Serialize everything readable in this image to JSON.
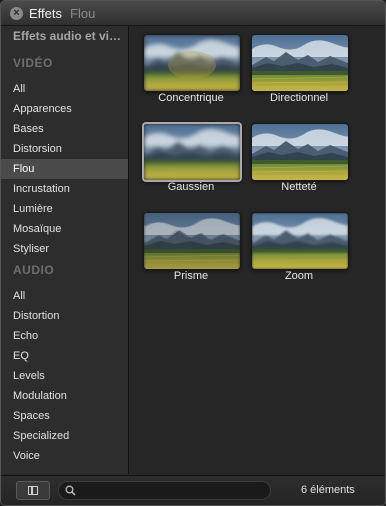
{
  "window": {
    "title": "Effets",
    "subtitle": "Flou"
  },
  "sidebar": {
    "root": "Effets audio et vi…",
    "video_header": "VIDÉO",
    "video_items": [
      "All",
      "Apparences",
      "Bases",
      "Distorsion",
      "Flou",
      "Incrustation",
      "Lumière",
      "Mosaïque",
      "Styliser"
    ],
    "audio_header": "AUDIO",
    "audio_items": [
      "All",
      "Distortion",
      "Echo",
      "EQ",
      "Levels",
      "Modulation",
      "Spaces",
      "Specialized",
      "Voice"
    ],
    "selected": "Flou"
  },
  "effects": [
    {
      "label": "Concentrique",
      "icon": "concentric-blur-thumbnail"
    },
    {
      "label": "Directionnel",
      "icon": "directional-blur-thumbnail"
    },
    {
      "label": "Gaussien",
      "icon": "gaussian-blur-thumbnail",
      "selected": true
    },
    {
      "label": "Netteté",
      "icon": "sharpen-thumbnail"
    },
    {
      "label": "Prisme",
      "icon": "prism-thumbnail"
    },
    {
      "label": "Zoom",
      "icon": "zoom-blur-thumbnail"
    }
  ],
  "footer": {
    "count": "6 éléments",
    "search_value": ""
  },
  "colors": {
    "background": "#262626",
    "sidebar": "#2d2d2d",
    "selection": "#4b4b4b"
  }
}
